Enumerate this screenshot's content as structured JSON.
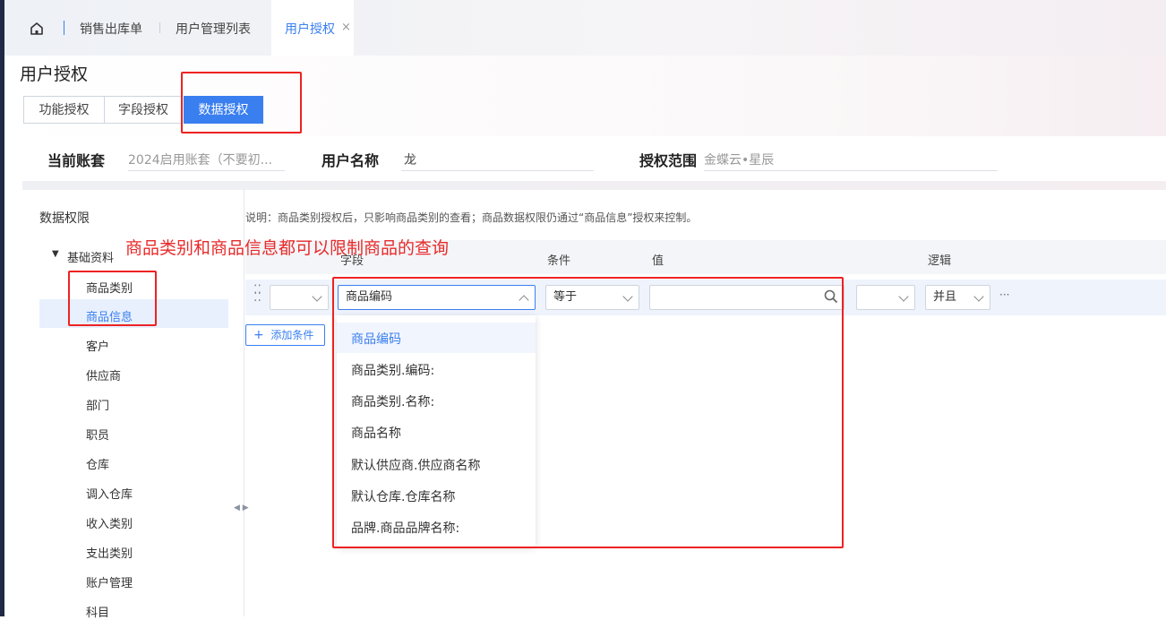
{
  "tabs": [
    {
      "label": "销售出库单"
    },
    {
      "label": "用户管理列表"
    },
    {
      "label": "用户授权",
      "close": "×"
    }
  ],
  "page": {
    "title": "用户授权"
  },
  "seg_tabs": [
    "功能授权",
    "字段授权",
    "数据授权"
  ],
  "info": {
    "account_label": "当前账套",
    "account_value": "2024启用账套（不要初...",
    "user_label": "用户名称",
    "user_value": "龙",
    "scope_label": "授权范围",
    "scope_value": "金蝶云•星辰"
  },
  "sidebar": {
    "title": "数据权限",
    "group": "基础资料",
    "items": [
      "商品类别",
      "商品信息",
      "客户",
      "供应商",
      "部门",
      "职员",
      "仓库",
      "调入仓库",
      "收入类别",
      "支出类别",
      "账户管理",
      "科目"
    ]
  },
  "notice": "说明：商品类别授权后，只影响商品类别的查看；商品数据权限仍通过“商品信息”授权来控制。",
  "annotation": "商品类别和商品信息都可以限制商品的查询",
  "table": {
    "headers": {
      "field": "字段",
      "condition": "条件",
      "value": "值",
      "logic": "逻辑"
    },
    "row": {
      "field": "商品编码",
      "condition": "等于",
      "logic": "并且",
      "more": "···"
    },
    "add_label": "添加条件"
  },
  "dropdown": [
    "商品编码",
    "商品类别.编码:",
    "商品类别.名称:",
    "商品名称",
    "默认供应商.供应商名称",
    "默认仓库.仓库名称",
    "品牌.商品品牌名称:"
  ],
  "colors": {
    "accent": "#3a7ff0",
    "annotation": "#e82a2a"
  }
}
